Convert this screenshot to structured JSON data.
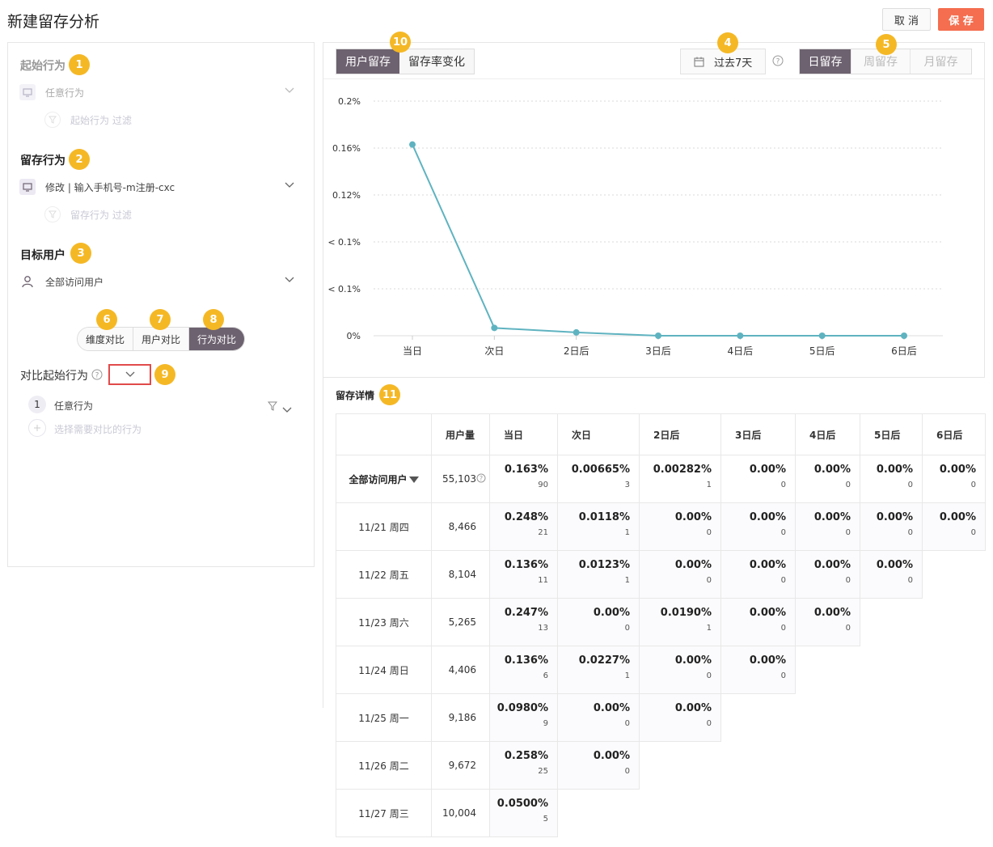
{
  "page": {
    "title": "新建留存分析"
  },
  "actions": {
    "cancel": "取 消",
    "save": "保 存"
  },
  "left": {
    "start_title": "起始行为",
    "start_value": "任意行为",
    "start_filter": "起始行为 过滤",
    "retain_title": "留存行为",
    "retain_value": "修改 | 输入手机号-m注册-cxc",
    "retain_filter": "留存行为 过滤",
    "target_title": "目标用户",
    "target_value": "全部访问用户",
    "compare_tabs": [
      "维度对比",
      "用户对比",
      "行为对比"
    ],
    "compare_start_title": "对比起始行为",
    "compare_item_index": "1",
    "compare_item": "任意行为",
    "compare_add": "选择需要对比的行为"
  },
  "badges": [
    "1",
    "2",
    "3",
    "4",
    "5",
    "6",
    "7",
    "8",
    "9",
    "10",
    "11"
  ],
  "view_tabs": [
    "用户留存",
    "留存率变化"
  ],
  "date_range": "过去7天",
  "retention_tabs": [
    "日留存",
    "周留存",
    "月留存"
  ],
  "chart_data": {
    "type": "line",
    "categories": [
      "当日",
      "次日",
      "2日后",
      "3日后",
      "4日后",
      "5日后",
      "6日后"
    ],
    "y_tick_labels": [
      "0.2%",
      "0.16%",
      "0.12%",
      "< 0.1%",
      "< 0.1%",
      "0%"
    ],
    "series": [
      {
        "values": [
          0.163,
          0.00665,
          0.00282,
          0.0,
          0.0,
          0.0,
          0.0
        ]
      }
    ],
    "ylim": [
      0,
      0.2
    ],
    "grid": true,
    "color": "#5fb3c0"
  },
  "detail": {
    "title": "留存详情",
    "headers": [
      "",
      "用户量",
      "当日",
      "次日",
      "2日后",
      "3日后",
      "4日后",
      "5日后",
      "6日后"
    ],
    "rows": [
      {
        "label": "全部访问用户",
        "users": "55,103",
        "cells": [
          [
            "0.163%",
            "90"
          ],
          [
            "0.00665%",
            "3"
          ],
          [
            "0.00282%",
            "1"
          ],
          [
            "0.00%",
            "0"
          ],
          [
            "0.00%",
            "0"
          ],
          [
            "0.00%",
            "0"
          ],
          [
            "0.00%",
            "0"
          ]
        ]
      },
      {
        "label": "11/21 周四",
        "users": "8,466",
        "cells": [
          [
            "0.248%",
            "21"
          ],
          [
            "0.0118%",
            "1"
          ],
          [
            "0.00%",
            "0"
          ],
          [
            "0.00%",
            "0"
          ],
          [
            "0.00%",
            "0"
          ],
          [
            "0.00%",
            "0"
          ],
          [
            "0.00%",
            "0"
          ]
        ]
      },
      {
        "label": "11/22 周五",
        "users": "8,104",
        "cells": [
          [
            "0.136%",
            "11"
          ],
          [
            "0.0123%",
            "1"
          ],
          [
            "0.00%",
            "0"
          ],
          [
            "0.00%",
            "0"
          ],
          [
            "0.00%",
            "0"
          ],
          [
            "0.00%",
            "0"
          ]
        ]
      },
      {
        "label": "11/23 周六",
        "users": "5,265",
        "cells": [
          [
            "0.247%",
            "13"
          ],
          [
            "0.00%",
            "0"
          ],
          [
            "0.0190%",
            "1"
          ],
          [
            "0.00%",
            "0"
          ],
          [
            "0.00%",
            "0"
          ]
        ]
      },
      {
        "label": "11/24 周日",
        "users": "4,406",
        "cells": [
          [
            "0.136%",
            "6"
          ],
          [
            "0.0227%",
            "1"
          ],
          [
            "0.00%",
            "0"
          ],
          [
            "0.00%",
            "0"
          ]
        ]
      },
      {
        "label": "11/25 周一",
        "users": "9,186",
        "cells": [
          [
            "0.0980%",
            "9"
          ],
          [
            "0.00%",
            "0"
          ],
          [
            "0.00%",
            "0"
          ]
        ]
      },
      {
        "label": "11/26 周二",
        "users": "9,672",
        "cells": [
          [
            "0.258%",
            "25"
          ],
          [
            "0.00%",
            "0"
          ]
        ]
      },
      {
        "label": "11/27 周三",
        "users": "10,004",
        "cells": [
          [
            "0.0500%",
            "5"
          ]
        ]
      }
    ]
  },
  "colors": {
    "accent": "#6d6270",
    "save": "#f46e4f",
    "badge": "#f5b825",
    "line": "#5fb3c0",
    "highlight": "#e14a4a"
  }
}
